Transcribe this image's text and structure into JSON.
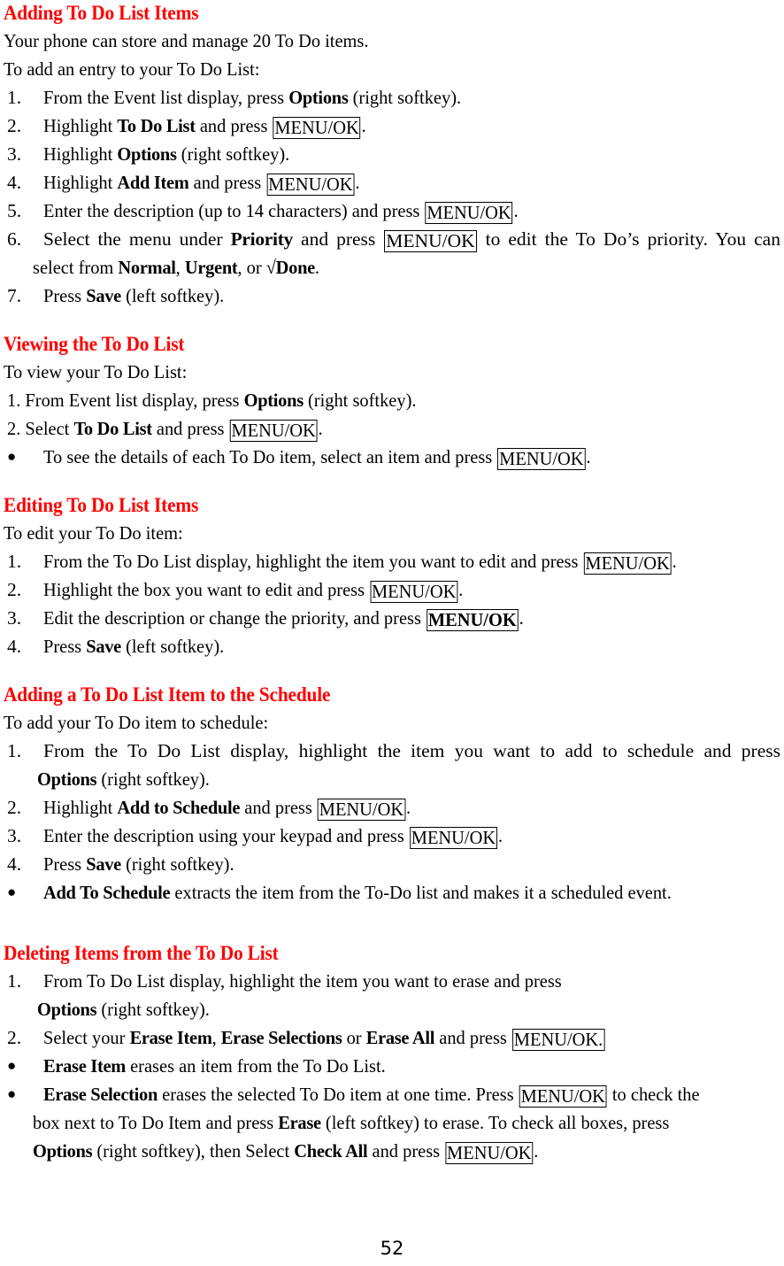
{
  "document": {
    "page_number": "52",
    "heading_color": "#ff0000",
    "text_color": "#000000"
  },
  "sections": [
    {
      "heading": "Adding To Do List Items",
      "intro": [
        "Your phone can store and manage 20 To Do items.",
        "To add an entry to your To Do List:"
      ],
      "items": [
        {
          "marker": "1.",
          "parts": [
            {
              "t": "From the Event list display, press "
            },
            {
              "t": "Options",
              "b": true
            },
            {
              "t": " (right softkey)."
            }
          ]
        },
        {
          "marker": "2.",
          "parts": [
            {
              "t": "Highlight "
            },
            {
              "t": "To Do List",
              "b": true
            },
            {
              "t": " and press "
            },
            {
              "t": "MENU/OK",
              "key": true
            },
            {
              "t": "."
            }
          ]
        },
        {
          "marker": "3.",
          "parts": [
            {
              "t": "Highlight "
            },
            {
              "t": "Options",
              "b": true
            },
            {
              "t": " (right softkey)."
            }
          ]
        },
        {
          "marker": "4.",
          "parts": [
            {
              "t": "Highlight "
            },
            {
              "t": "Add Item",
              "b": true
            },
            {
              "t": " and press "
            },
            {
              "t": "MENU/OK",
              "key": true
            },
            {
              "t": "."
            }
          ]
        },
        {
          "marker": "5.",
          "parts": [
            {
              "t": "Enter the description (up to 14 characters) and press "
            },
            {
              "t": "MENU/OK",
              "key": true
            },
            {
              "t": "."
            }
          ]
        },
        {
          "marker": "6.",
          "justify": true,
          "parts": [
            {
              "t": "Select the menu under "
            },
            {
              "t": "Priority",
              "b": true
            },
            {
              "t": " and press "
            },
            {
              "t": "MENU/OK",
              "key": true
            },
            {
              "t": " to edit the To Do’s priority. You can"
            }
          ],
          "cont": [
            {
              "t": "select from "
            },
            {
              "t": "Normal",
              "b": true
            },
            {
              "t": ", "
            },
            {
              "t": "Urgent",
              "b": true
            },
            {
              "t": ", or "
            },
            {
              "t": "√Done",
              "b": true
            },
            {
              "t": "."
            }
          ]
        },
        {
          "marker": "7.",
          "parts": [
            {
              "t": "Press "
            },
            {
              "t": "Save",
              "b": true
            },
            {
              "t": " (left softkey)."
            }
          ]
        }
      ]
    },
    {
      "heading": "Viewing the To Do List",
      "intro": [
        "To view your To Do List:"
      ],
      "items": [
        {
          "marker": "1.",
          "flush": true,
          "parts": [
            {
              "t": "1. From Event list display, press "
            },
            {
              "t": "Options",
              "b": true
            },
            {
              "t": " (right softkey)."
            }
          ]
        },
        {
          "marker": "2.",
          "flush": true,
          "parts": [
            {
              "t": "2. Select "
            },
            {
              "t": "To Do List",
              "b": true
            },
            {
              "t": " and press "
            },
            {
              "t": "MENU/OK",
              "key": true
            },
            {
              "t": "."
            }
          ]
        },
        {
          "marker": "●",
          "bullet": true,
          "parts": [
            {
              "t": "To see the details of each To Do item, select an item and press "
            },
            {
              "t": "MENU/OK",
              "key": true
            },
            {
              "t": "."
            }
          ]
        }
      ]
    },
    {
      "heading": "Editing To Do List Items",
      "intro": [
        "To edit your To Do item:"
      ],
      "items": [
        {
          "marker": "1.",
          "parts": [
            {
              "t": "From the To Do List display, highlight the item you want to edit and press "
            },
            {
              "t": "MENU/OK",
              "key": true
            },
            {
              "t": "."
            }
          ]
        },
        {
          "marker": "2.",
          "parts": [
            {
              "t": "Highlight the box you want to edit and press "
            },
            {
              "t": "MENU/OK",
              "key": true
            },
            {
              "t": "."
            }
          ]
        },
        {
          "marker": "3.",
          "parts": [
            {
              "t": "Edit the description or change the priority, and press "
            },
            {
              "t": "MENU/OK",
              "key": true,
              "b": true
            },
            {
              "t": "."
            }
          ]
        },
        {
          "marker": "4.",
          "parts": [
            {
              "t": "Press "
            },
            {
              "t": "Save",
              "b": true
            },
            {
              "t": " (left softkey)."
            }
          ]
        }
      ]
    },
    {
      "heading": "Adding a To Do List Item to the Schedule",
      "intro": [
        "To add your To Do item to schedule:"
      ],
      "items": [
        {
          "marker": "1.",
          "justify": true,
          "parts": [
            {
              "t": "From the To Do List display, highlight the item you want to add to schedule and press"
            }
          ],
          "cont": [
            {
              "t": "Options",
              "b": true
            },
            {
              "t": " (right softkey)."
            }
          ],
          "cont_deep": true
        },
        {
          "marker": "2.",
          "parts": [
            {
              "t": "Highlight "
            },
            {
              "t": "Add to Schedule",
              "b": true
            },
            {
              "t": " and press "
            },
            {
              "t": "MENU/OK",
              "key": true
            },
            {
              "t": "."
            }
          ]
        },
        {
          "marker": "3.",
          "parts": [
            {
              "t": "Enter the description using your keypad and press "
            },
            {
              "t": "MENU/OK",
              "key": true
            },
            {
              "t": "."
            }
          ]
        },
        {
          "marker": "4.",
          "parts": [
            {
              "t": "Press "
            },
            {
              "t": "Save",
              "b": true
            },
            {
              "t": " (right softkey)."
            }
          ]
        },
        {
          "marker": "●",
          "bullet": true,
          "parts": [
            {
              "t": "Add To Schedule",
              "b": true
            },
            {
              "t": " extracts the item from the To-Do list and makes it a scheduled event."
            }
          ]
        }
      ]
    },
    {
      "heading": "Deleting Items from the To Do List",
      "intro": [],
      "items": [
        {
          "marker": "1.",
          "parts": [
            {
              "t": "From To Do List display, highlight the item you want to erase and press"
            }
          ],
          "cont": [
            {
              "t": "Options",
              "b": true
            },
            {
              "t": " (right softkey)."
            }
          ],
          "cont_deep": true
        },
        {
          "marker": "2.",
          "parts": [
            {
              "t": "Select your "
            },
            {
              "t": "Erase Item",
              "b": true
            },
            {
              "t": ", "
            },
            {
              "t": "Erase Selections",
              "b": true
            },
            {
              "t": " or "
            },
            {
              "t": "Erase All",
              "b": true
            },
            {
              "t": " and press "
            },
            {
              "t": "MENU/OK.",
              "key": true
            }
          ]
        },
        {
          "marker": "●",
          "bullet": true,
          "parts": [
            {
              "t": "Erase Item",
              "b": true
            },
            {
              "t": " erases an item from the To Do List."
            }
          ]
        },
        {
          "marker": "●",
          "bullet": true,
          "parts": [
            {
              "t": "Erase Selection",
              "b": true
            },
            {
              "t": " erases the selected To Do item at one time. Press "
            },
            {
              "t": "MENU/OK",
              "key": true
            },
            {
              "t": " to check the"
            }
          ],
          "cont": [
            {
              "t": "box next to To Do Item and press "
            },
            {
              "t": "Erase",
              "b": true
            },
            {
              "t": " (left softkey) to erase. To check all boxes, press"
            }
          ],
          "cont2": [
            {
              "t": "Options",
              "b": true
            },
            {
              "t": " (right softkey), then Select "
            },
            {
              "t": "Check All",
              "b": true
            },
            {
              "t": " and press "
            },
            {
              "t": "MENU/OK",
              "key": true
            },
            {
              "t": "."
            }
          ]
        }
      ]
    }
  ]
}
